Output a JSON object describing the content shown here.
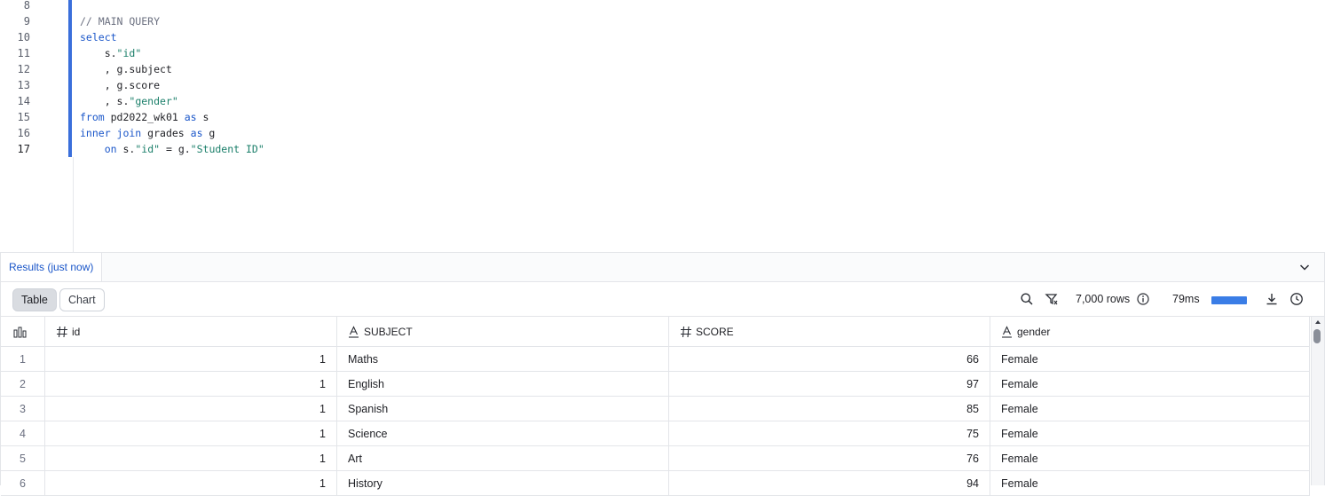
{
  "editor": {
    "line_numbers": [
      "8",
      "9",
      "10",
      "11",
      "12",
      "13",
      "14",
      "15",
      "16",
      "17"
    ],
    "active_line": "17",
    "lines": [
      [],
      [
        {
          "t": "// MAIN QUERY",
          "c": "cm"
        }
      ],
      [
        {
          "t": "select",
          "c": "kw"
        }
      ],
      [
        {
          "t": "    s.",
          "c": ""
        },
        {
          "t": "\"id\"",
          "c": "str"
        }
      ],
      [
        {
          "t": "    , g.subject",
          "c": ""
        }
      ],
      [
        {
          "t": "    , g.score",
          "c": ""
        }
      ],
      [
        {
          "t": "    , s.",
          "c": ""
        },
        {
          "t": "\"gender\"",
          "c": "str"
        }
      ],
      [
        {
          "t": "from",
          "c": "kw"
        },
        {
          "t": " pd2022_wk01 ",
          "c": ""
        },
        {
          "t": "as",
          "c": "kw"
        },
        {
          "t": " s",
          "c": ""
        }
      ],
      [
        {
          "t": "inner join",
          "c": "kw"
        },
        {
          "t": " grades ",
          "c": ""
        },
        {
          "t": "as",
          "c": "kw"
        },
        {
          "t": " g",
          "c": ""
        }
      ],
      [
        {
          "t": "    ",
          "c": ""
        },
        {
          "t": "on",
          "c": "kw"
        },
        {
          "t": " s.",
          "c": ""
        },
        {
          "t": "\"id\"",
          "c": "str"
        },
        {
          "t": " = g.",
          "c": ""
        },
        {
          "t": "\"Student ID\"",
          "c": "str"
        }
      ]
    ]
  },
  "results": {
    "tab_label": "Results (just now)",
    "view_table": "Table",
    "view_chart": "Chart",
    "row_count": "7,000 rows",
    "elapsed": "79ms",
    "progress": 1.0,
    "accent": "#3a7de6",
    "columns": [
      {
        "name": "id",
        "type": "number"
      },
      {
        "name": "SUBJECT",
        "type": "text"
      },
      {
        "name": "SCORE",
        "type": "number"
      },
      {
        "name": "gender",
        "type": "text"
      }
    ],
    "rows": [
      [
        "1",
        "1",
        "Maths",
        "66",
        "Female"
      ],
      [
        "2",
        "1",
        "English",
        "97",
        "Female"
      ],
      [
        "3",
        "1",
        "Spanish",
        "85",
        "Female"
      ],
      [
        "4",
        "1",
        "Science",
        "75",
        "Female"
      ],
      [
        "5",
        "1",
        "Art",
        "76",
        "Female"
      ],
      [
        "6",
        "1",
        "History",
        "94",
        "Female"
      ]
    ]
  },
  "icons": [
    "collapse-chevron-icon",
    "search-icon",
    "filter-icon",
    "info-icon",
    "download-icon",
    "history-clock-icon",
    "column-stats-icon",
    "number-type-icon",
    "text-type-icon"
  ]
}
